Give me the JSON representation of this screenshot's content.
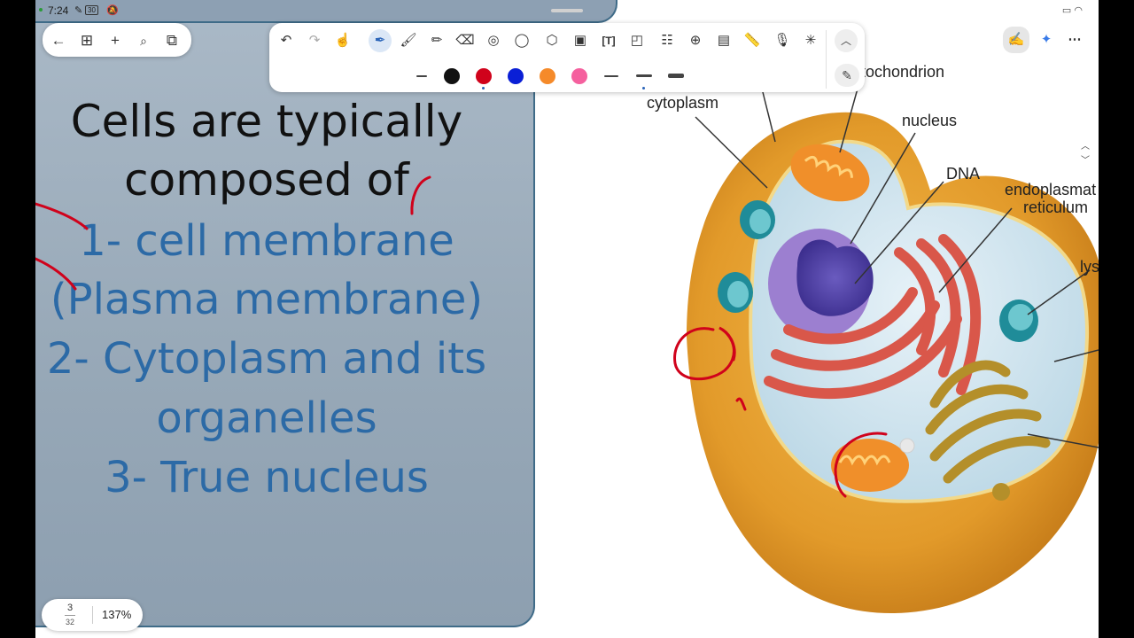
{
  "status_bar": {
    "time": "7:24",
    "badge": "30"
  },
  "nav_pill": {
    "icons": [
      "back-arrow-icon",
      "grid-icon",
      "plus-icon",
      "search-icon",
      "stack-icon"
    ]
  },
  "toolbar": {
    "tools": [
      "undo-icon",
      "redo-icon",
      "touch-hand-icon",
      "pen-icon",
      "brush-icon",
      "highlighter-icon",
      "eraser-icon",
      "lasso-circle-icon",
      "lasso-icon",
      "shapes-icon",
      "image-icon",
      "text-icon",
      "sticky-note-icon",
      "table-icon",
      "zoom-icon",
      "chart-icon",
      "ruler-icon",
      "mic-icon",
      "laser-icon"
    ],
    "active_tool": "pen",
    "colors": [
      "#111111",
      "#d0021b",
      "#0a1fd6",
      "#f58a2a",
      "#f5609e"
    ],
    "selected_color": "#d0021b",
    "selected_thickness": "medium"
  },
  "slide": {
    "line1": "Cells are typically",
    "line2": "composed of",
    "item1a": "1- cell membrane",
    "item1b": "(Plasma membrane)",
    "item2a": "2- Cytoplasm and its",
    "item2b": "organelles",
    "item3": "3- True nucleus"
  },
  "diagram": {
    "labels": {
      "mitochondrion": "tochondrion",
      "cytoplasm": "cytoplasm",
      "nucleus": "nucleus",
      "dna": "DNA",
      "er_line1": "endoplasmat",
      "er_line2": "reticulum",
      "lysosome": "lys"
    }
  },
  "page_indicator": {
    "current": "3",
    "total": "32",
    "zoom": "137%"
  },
  "accent_colors": {
    "panel_border": "#3f6b88",
    "slide_blue_text": "#2c6aa6",
    "ink_red": "#d0021b"
  }
}
